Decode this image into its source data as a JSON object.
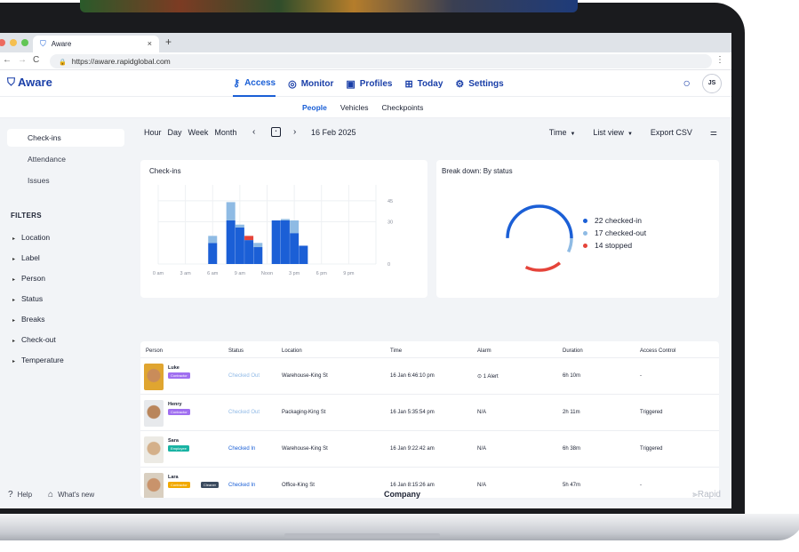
{
  "browser": {
    "tab_title": "Aware",
    "tab_close": "×",
    "new_tab": "+",
    "url": "https://aware.rapidglobal.com"
  },
  "app": {
    "logo_text": "Aware",
    "nav": [
      {
        "label": "Access",
        "icon": "key-icon"
      },
      {
        "label": "Monitor",
        "icon": "monitor-icon"
      },
      {
        "label": "Profiles",
        "icon": "profile-card-icon"
      },
      {
        "label": "Today",
        "icon": "grid-icon"
      },
      {
        "label": "Settings",
        "icon": "gear-icon"
      }
    ],
    "user_initials": "JS",
    "subnav": [
      "People",
      "Vehicles",
      "Checkpoints"
    ]
  },
  "sidebar": {
    "links": [
      "Check-ins",
      "Attendance",
      "Issues"
    ],
    "filters_title": "FILTERS",
    "filters": [
      "Location",
      "Label",
      "Person",
      "Status",
      "Breaks",
      "Check-out",
      "Temperature"
    ],
    "help": "Help",
    "whats_new": "What's new"
  },
  "toolbar": {
    "periods": [
      "Hour",
      "Day",
      "Week",
      "Month"
    ],
    "date": "16 Feb 2025",
    "time_label": "Time",
    "view_label": "List view",
    "export_label": "Export CSV"
  },
  "checkins_chart": {
    "title": "Check-ins",
    "chart_data": {
      "type": "bar",
      "stacked": true,
      "x_tick_labels": [
        "0 am",
        "3 am",
        "6 am",
        "9 am",
        "Noon",
        "3 pm",
        "6 pm",
        "9 pm"
      ],
      "y_tick_labels": [
        "0",
        "30",
        "45"
      ],
      "ylim": [
        0,
        55
      ],
      "bar_positions_hours": [
        6,
        8,
        9,
        10,
        11,
        13,
        14,
        15,
        16
      ],
      "series": [
        {
          "color": "#1b5fd6",
          "values": [
            15,
            31,
            26,
            17,
            12,
            31,
            31,
            22,
            13
          ]
        },
        {
          "color": "#e5443a",
          "values": [
            0,
            0,
            0,
            3,
            0,
            0,
            0,
            0,
            0
          ]
        },
        {
          "color": "#8fbbe4",
          "values": [
            5,
            13,
            2,
            0,
            3,
            0,
            1,
            9,
            0
          ]
        }
      ]
    }
  },
  "status_chart": {
    "title": "Break down: By status",
    "chart_data": {
      "type": "pie",
      "donut": true,
      "slices": [
        {
          "label": "22 checked-in",
          "value": 22,
          "color": "#1b5fd6"
        },
        {
          "label": "17 checked-out",
          "value": 17,
          "color": "#8fbbe4"
        },
        {
          "label": "14 stopped",
          "value": 14,
          "color": "#e5443a"
        }
      ],
      "ring_display_fractions": {
        "checked-in": 0.57,
        "checked-out": 0.25,
        "stopped": 0.18
      }
    }
  },
  "table": {
    "headers": [
      "Person",
      "Status",
      "Location",
      "Time",
      "Alarm",
      "Duration",
      "Access Control"
    ],
    "rows": [
      {
        "name": "Luke",
        "badges": [
          {
            "text": "Contractor",
            "color": "#a06ff0"
          }
        ],
        "status": "Checked Out",
        "location": "Warehouse-King St",
        "time": "16 Jan 6:46:10 pm",
        "alarm": "⊙ 1 Alert",
        "duration": "6h 10m",
        "access": "-",
        "photo_bg": "#e0a530",
        "photo_fg": "#c98c5a"
      },
      {
        "name": "Henry",
        "badges": [
          {
            "text": "Contractor",
            "color": "#a06ff0"
          }
        ],
        "status": "Checked Out",
        "location": "Packaging-King St",
        "time": "16 Jan 5:35:54 pm",
        "alarm": "N/A",
        "duration": "2h 11m",
        "access": "Triggered",
        "photo_bg": "#e7e9ec",
        "photo_fg": "#b9855b"
      },
      {
        "name": "Sara",
        "badges": [
          {
            "text": "Employee",
            "color": "#19b3a3"
          }
        ],
        "status": "Checked In",
        "location": "Warehouse-King St",
        "time": "16 Jan 9:22:42 am",
        "alarm": "N/A",
        "duration": "6h 38m",
        "access": "Triggered",
        "photo_bg": "#eceae4",
        "photo_fg": "#d4b08a"
      },
      {
        "name": "Lara",
        "badges": [
          {
            "text": "Contractor",
            "color": "#f2a900"
          },
          {
            "text": "Cleaner",
            "color": "#3a4a5e"
          }
        ],
        "status": "Checked In",
        "location": "Office-King St",
        "time": "16 Jan 8:15:26 am",
        "alarm": "N/A",
        "duration": "5h 47m",
        "access": "-",
        "photo_bg": "#d9cfc0",
        "photo_fg": "#c9936b"
      }
    ]
  },
  "footer": {
    "company": "Company",
    "brand": "Rapid"
  }
}
